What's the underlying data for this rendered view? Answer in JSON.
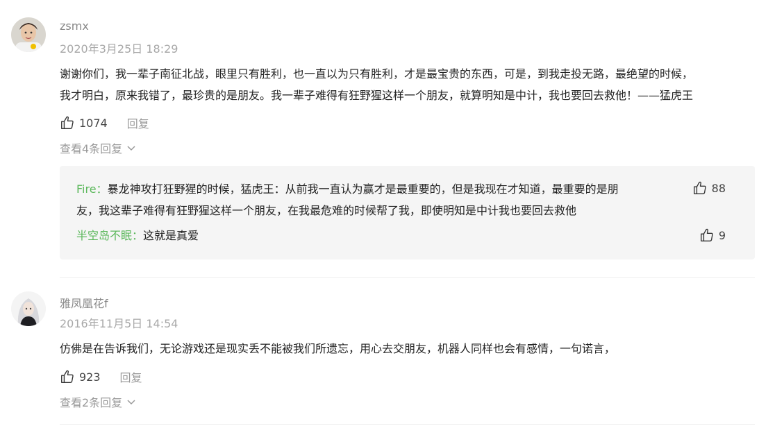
{
  "comments": [
    {
      "username": "zsmx",
      "timestamp": "2020年3月25日 18:29",
      "content_lines": [
        "谢谢你们，我一辈子南征北战，眼里只有胜利，也一直以为只有胜利，才是最宝贵的东西，可是，到我走投无路，最绝望的时候，",
        "我才明白，原来我错了，最珍贵的是朋友。我一辈子难得有狂野猩这样一个朋友，就算明知是中计，我也要回去救他！——猛虎王"
      ],
      "like_count": "1074",
      "reply_label": "回复",
      "view_replies_label": "查看4条回复",
      "replies": [
        {
          "author": "Fire：",
          "lines": [
            "暴龙神攻打狂野猩的时候，猛虎王：从前我一直认为赢才是最重要的，但是我现在才知道，最重要的是朋",
            "友，我这辈子难得有狂野猩这样一个朋友，在我最危难的时候帮了我，即使明知是中计我也要回去救他"
          ],
          "like_count": "88"
        },
        {
          "author": "半空岛不眠：",
          "lines": [
            "这就是真爱"
          ],
          "like_count": "9"
        }
      ]
    },
    {
      "username": "雅凤凰花f",
      "timestamp": "2016年11月5日 14:54",
      "content_lines": [
        "仿佛是在告诉我们，无论游戏还是现实丢不能被我们所遗忘，用心去交朋友，机器人同样也会有感情，一句诺言，"
      ],
      "like_count": "923",
      "reply_label": "回复",
      "view_replies_label": "查看2条回复"
    }
  ],
  "colors": {
    "reply_author": "#5cb85c",
    "reply_box_bg": "#f5f5f5"
  }
}
